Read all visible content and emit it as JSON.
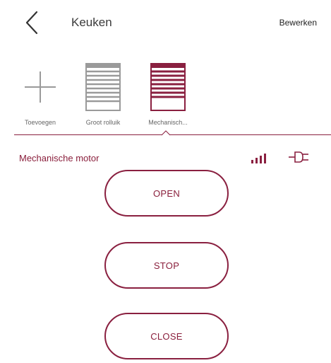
{
  "header": {
    "title": "Keuken",
    "edit_label": "Bewerken"
  },
  "devices": [
    {
      "label": "Toevoegen",
      "icon": "plus-icon",
      "selected": false
    },
    {
      "label": "Groot rolluik",
      "icon": "roller-shutter-icon",
      "selected": false
    },
    {
      "label": "Mechanisch...",
      "icon": "roller-shutter-icon",
      "selected": true
    }
  ],
  "device_panel": {
    "name": "Mechanische motor",
    "signal_icon": "signal-strength-icon",
    "power_icon": "plug-icon"
  },
  "controls": {
    "open_label": "OPEN",
    "stop_label": "STOP",
    "close_label": "CLOSE"
  },
  "colors": {
    "accent": "#8a2040",
    "inactive_icon": "#9a9a9a",
    "text": "#333333"
  }
}
